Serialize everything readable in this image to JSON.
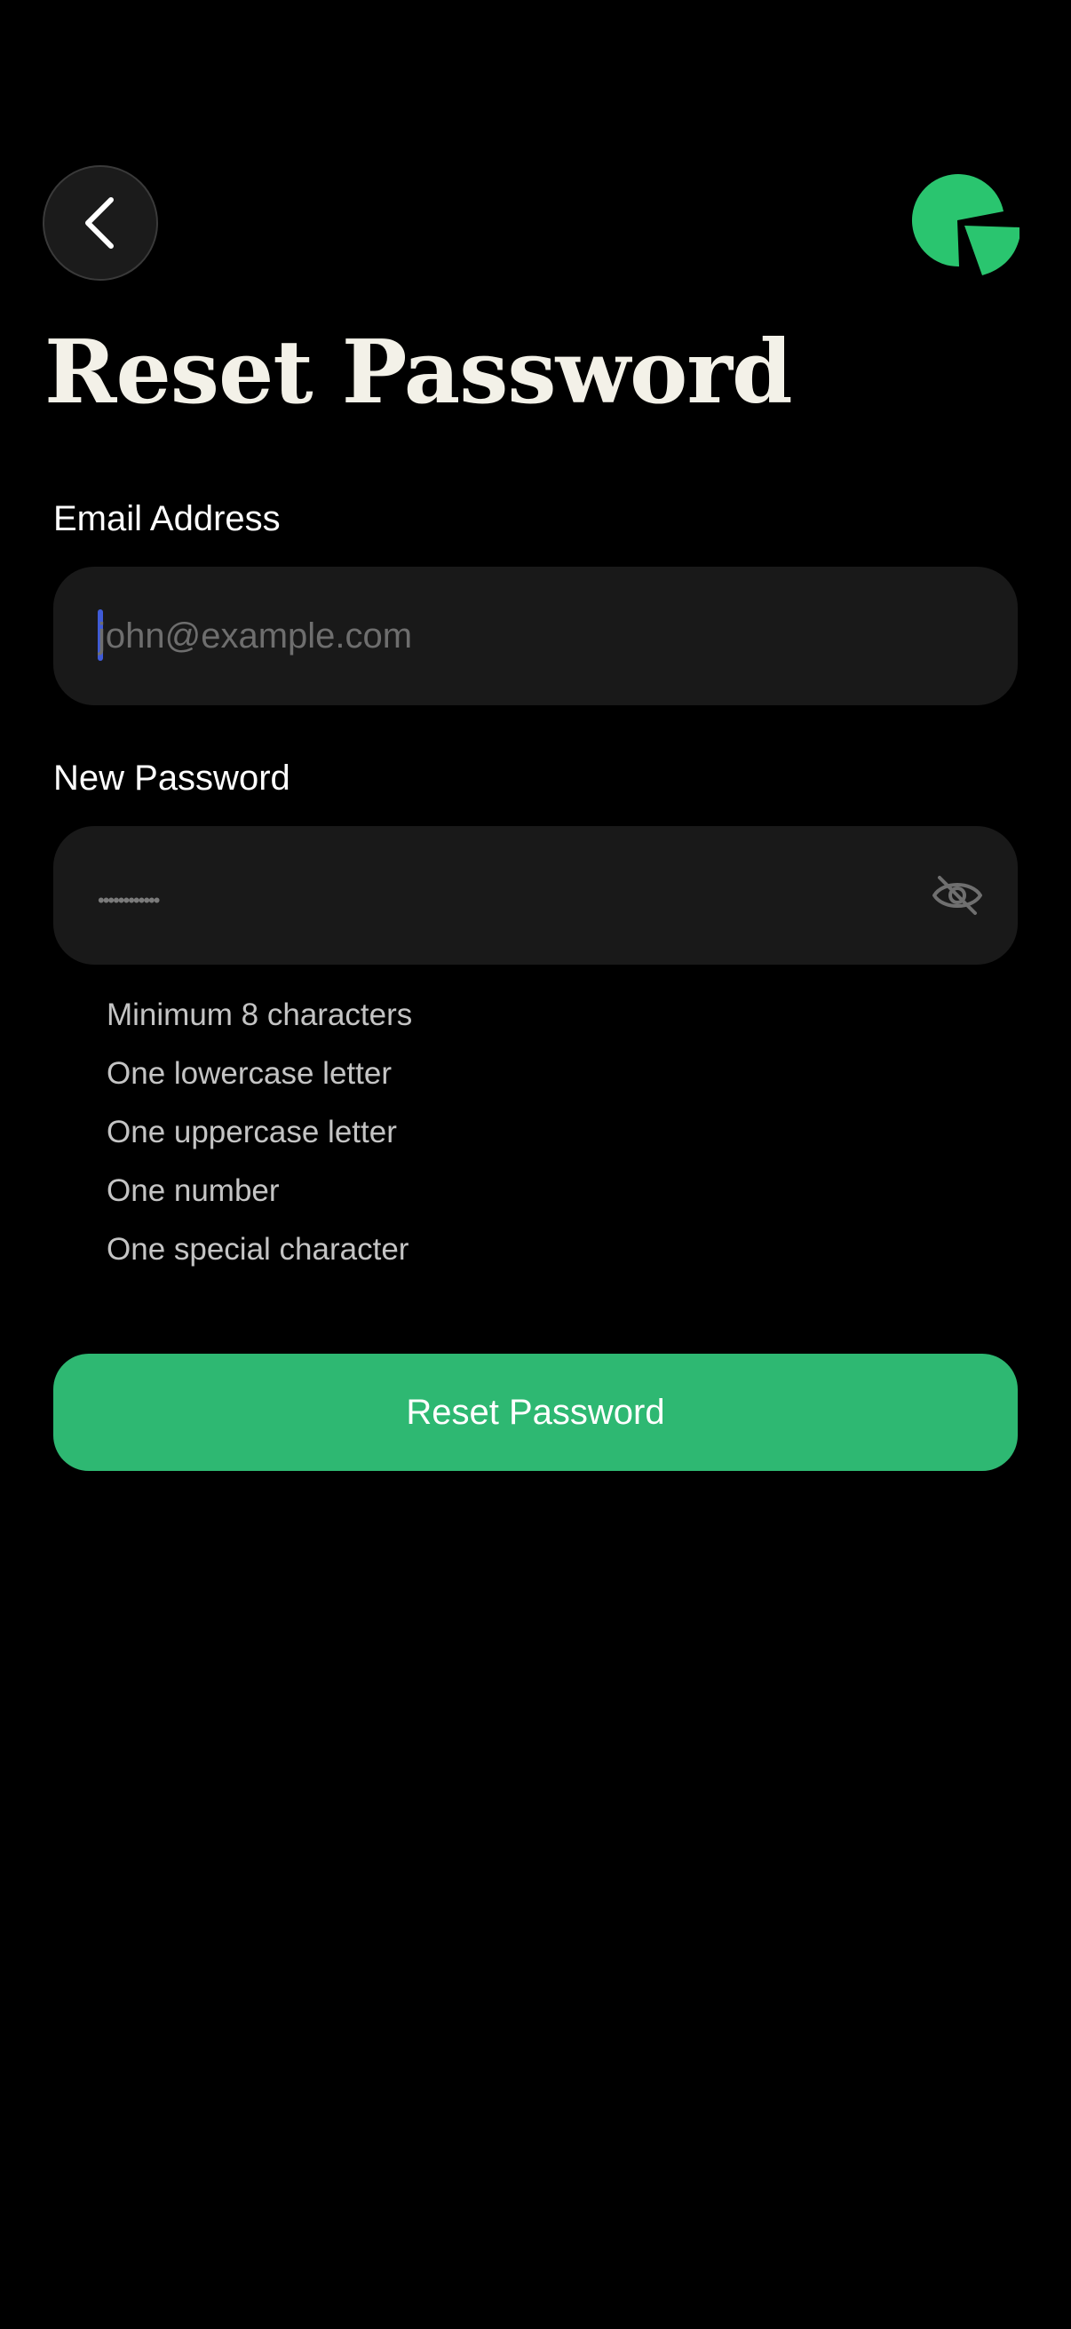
{
  "header": {
    "back_icon": "chevron-left-icon",
    "logo_icon": "pie-chart-logo-icon"
  },
  "page": {
    "title": "Reset Password"
  },
  "form": {
    "email": {
      "label": "Email Address",
      "placeholder": "john@example.com",
      "value": ""
    },
    "password": {
      "label": "New Password",
      "placeholder": "••••••••••••",
      "value": "",
      "toggle_icon": "eye-off-icon"
    },
    "requirements": [
      "Minimum 8 characters",
      "One lowercase letter",
      "One uppercase letter",
      "One number",
      "One special character"
    ],
    "submit_label": "Reset Password"
  },
  "colors": {
    "background": "#000000",
    "input_background": "#191919",
    "accent": "#2eb872",
    "title": "#f3f1e8",
    "caret": "#3f5bd8"
  }
}
